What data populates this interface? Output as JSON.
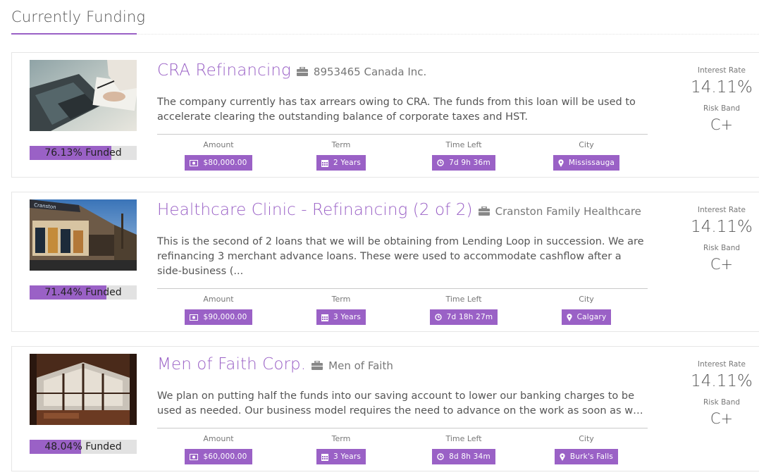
{
  "page": {
    "title": "Currently Funding",
    "colors": {
      "accent": "#9a61c6",
      "progress_track": "#e2e2e2",
      "text": "#555555"
    }
  },
  "loans": [
    {
      "title": "CRA Refinancing",
      "company": "8953465 Canada Inc.",
      "description": "The company currently has tax arrears owing to CRA. The funds from this loan will be used to accelerate clearing the outstanding balance of corporate taxes and HST.",
      "funded_percent": 76.13,
      "funded_label": "76.13% Funded",
      "image": "laptop-desk-photo",
      "stats": {
        "amount_label": "Amount",
        "amount": "$80,000.00",
        "term_label": "Term",
        "term": "2 Years",
        "time_left_label": "Time Left",
        "time_left": "7d 9h 36m",
        "city_label": "City",
        "city": "Mississauga"
      },
      "interest_rate_label": "Interest Rate",
      "interest_rate": "14.11%",
      "risk_band_label": "Risk Band",
      "risk_band": "C+"
    },
    {
      "title": "Healthcare Clinic - Refinancing (2 of 2)",
      "company": "Cranston Family Healthcare",
      "description": "This is the second of 2 loans that we will be obtaining from Lending Loop in succession. We are refinancing 3 merchant advance loans. These were used to accommodate cashflow after a side-business (...",
      "funded_percent": 71.44,
      "funded_label": "71.44% Funded",
      "image": "clinic-building-photo",
      "stats": {
        "amount_label": "Amount",
        "amount": "$90,000.00",
        "term_label": "Term",
        "term": "3 Years",
        "time_left_label": "Time Left",
        "time_left": "7d 18h 27m",
        "city_label": "City",
        "city": "Calgary"
      },
      "interest_rate_label": "Interest Rate",
      "interest_rate": "14.11%",
      "risk_band_label": "Risk Band",
      "risk_band": "C+"
    },
    {
      "title": "Men of Faith Corp.",
      "company": "Men of Faith",
      "description": "We plan on putting half the funds into our saving account to lower our banking charges to be used as needed. Our business model requires the need to advance on the work as soon as we have a contract in hand.",
      "funded_percent": 48.04,
      "funded_label": "48.04% Funded",
      "image": "cabin-interior-photo",
      "stats": {
        "amount_label": "Amount",
        "amount": "$60,000.00",
        "term_label": "Term",
        "term": "3 Years",
        "time_left_label": "Time Left",
        "time_left": "8d 8h 34m",
        "city_label": "City",
        "city": "Burk's Falls"
      },
      "interest_rate_label": "Interest Rate",
      "interest_rate": "14.11%",
      "risk_band_label": "Risk Band",
      "risk_band": "C+"
    }
  ]
}
